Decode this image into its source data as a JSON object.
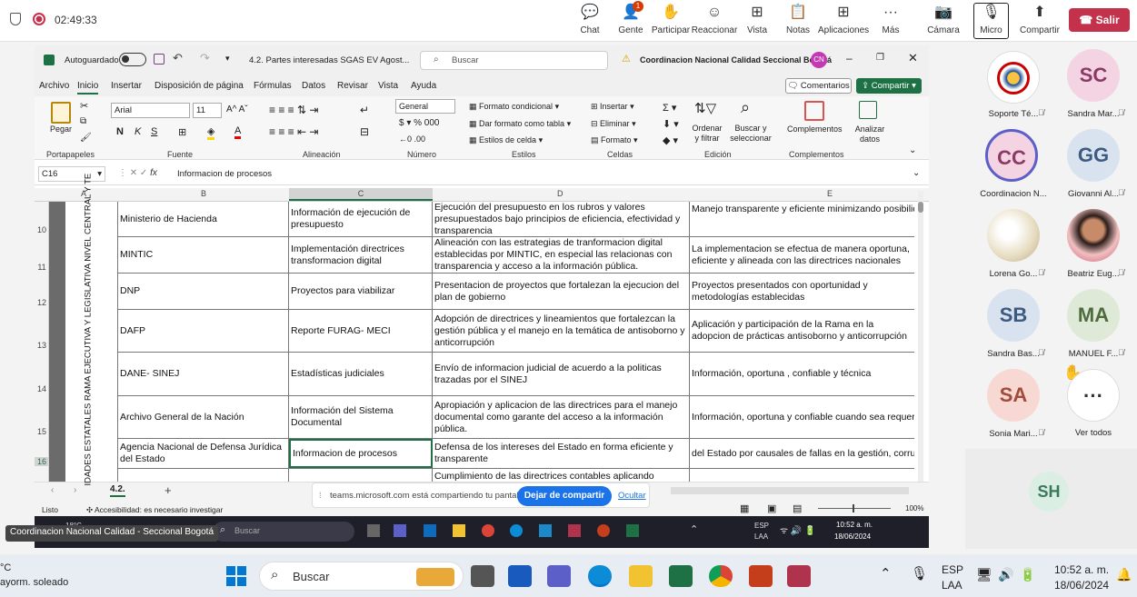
{
  "teams": {
    "timer": "02:49:33",
    "chat": "Chat",
    "people": "Gente",
    "people_badge": "1",
    "raise": "Participar",
    "react": "Reaccionar",
    "view": "Vista",
    "notes": "Notas",
    "apps": "Aplicaciones",
    "more": "Más",
    "camera": "Cámara",
    "mic": "Micro",
    "share": "Compartir",
    "leave": "Salir"
  },
  "excel": {
    "autosave": "Autoguardado",
    "filename": "4.2. Partes interesadas SGAS EV Agost...",
    "search_placeholder": "Buscar",
    "org": "Coordinacion Nacional Calidad Seccional Bogotá",
    "user_initials": "CN",
    "menus": [
      "Archivo",
      "Inicio",
      "Insertar",
      "Disposición de página",
      "Fórmulas",
      "Datos",
      "Revisar",
      "Vista",
      "Ayuda"
    ],
    "comments": "Comentarios",
    "share": "Compartir",
    "ribbon": {
      "paste": "Pegar",
      "clipboard": "Portapapeles",
      "font_name": "Arial",
      "font_size": "11",
      "font_group": "Fuente",
      "align_group": "Alineación",
      "number_format": "General",
      "number_group": "Número",
      "cond_format": "Formato condicional",
      "table_format": "Dar formato como tabla",
      "cell_styles": "Estilos de celda",
      "styles_group": "Estilos",
      "insert": "Insertar",
      "delete": "Eliminar",
      "format": "Formato",
      "cells_group": "Celdas",
      "sort_filter": "Ordenar y filtrar",
      "find_select": "Buscar y seleccionar",
      "edit_group": "Edición",
      "complements": "Complementos",
      "complements_group": "Complementos",
      "analyze": "Analizar datos"
    },
    "name_box": "C16",
    "formula": "Informacion de procesos",
    "columns": [
      "A",
      "B",
      "C",
      "D",
      "E"
    ],
    "merged_a": "IDADES ESTATALES RAMA EJECUTIVA Y LEGISLATIVA NIVEL CENTRAL Y TE",
    "rows": [
      {
        "num": "10",
        "b": "Ministerio de Hacienda",
        "c": "Información de ejecución de presupuesto",
        "d": "Ejecución del presupuesto en los rubros y valores presupuestados bajo principios de eficiencia, efectividad y transparencia",
        "e": "Manejo transparente y eficiente minimizando posibilidades de soborno y corrupción."
      },
      {
        "num": "11",
        "b": "MINTIC",
        "c": "Implementación directrices transformacion digital",
        "d": "Alineación con las estrategias de tranformacion digital establecidas por MINTIC, en especial las relacionas con transparencia y acceso a la información pública.",
        "e": "La implementacion se efectua de manera oportuna, eficiente y alineada con las directrices nacionales"
      },
      {
        "num": "12",
        "b": "DNP",
        "c": "Proyectos para viabilizar",
        "d": "Presentacion de proyectos que fortalezan la ejecucion del plan de gobierno",
        "e": "Proyectos presentados con oportunidad y metodologías establecidas"
      },
      {
        "num": "13",
        "b": "DAFP",
        "c": "Reporte FURAG- MECI",
        "d": "Adopción de directrices y lineamientos que fortalezcan la gestión pública y el manejo en la temática de antisoborno y anticorrupción",
        "e": "Aplicación y participación de la Rama en la adopcion de prácticas antisoborno y anticorrupción"
      },
      {
        "num": "14",
        "b": "DANE- SINEJ",
        "c": "Estadísticas judiciales",
        "d": "Envío de informacion judicial de acuerdo a la politicas trazadas por el SINEJ",
        "e": "Información, oportuna , confiable y técnica"
      },
      {
        "num": "15",
        "b": "Archivo General de la Nación",
        "c": "Información del Sistema Documental",
        "d": "Apropiación y aplicacion de las directrices para el manejo documental como garante del acceso a la información pública.",
        "e": "Información, oportuna y confiable cuando sea requerida"
      },
      {
        "num": "16",
        "b": "Agencia Nacional de Defensa Jurídica del Estado",
        "c": "Informacion de procesos",
        "d": "Defensa de los intereses del Estado en forma eficiente y transparente",
        "e": "del Estado por causales de fallas en la gestión, corrupción o soborno"
      },
      {
        "num": "",
        "b": "",
        "c": "",
        "d": "Cumplimiento de las directrices contables aplicando",
        "e": ""
      }
    ],
    "sheet_tab": "4.2.",
    "status_ready": "Listo",
    "accessibility": "Accesibilidad: es necesario investigar",
    "zoom": "100%",
    "share_notice": "teams.microsoft.com está compartiendo tu pantalla.",
    "stop_sharing": "Dejar de compartir",
    "hide": "Ocultar",
    "inner_taskbar": {
      "owner": "Coordinacion Nacional Calidad - Seccional Bogotá",
      "temp": "18°C",
      "search": "Buscar",
      "lang": "ESP",
      "lang2": "LAA",
      "time": "10:52 a. m.",
      "date": "18/06/2024"
    }
  },
  "participants": [
    {
      "initials": "",
      "name": "Soporte Té...",
      "bg": "#ffffff",
      "fg": "#333"
    },
    {
      "initials": "SC",
      "name": "Sandra Mar...",
      "bg": "#f4d3e2",
      "fg": "#8a3a64"
    },
    {
      "initials": "CC",
      "name": "Coordinacion N...",
      "bg": "#f4d3e2",
      "fg": "#8a3a64"
    },
    {
      "initials": "GG",
      "name": "Giovanni Al...",
      "bg": "#d9e3f0",
      "fg": "#3d5a80"
    },
    {
      "initials": "",
      "name": "Lorena Go...",
      "bg": "#ece6d4",
      "fg": "#333"
    },
    {
      "initials": "",
      "name": "Beatriz Eug...",
      "bg": "#c97a70",
      "fg": "#333"
    },
    {
      "initials": "SB",
      "name": "Sandra Bas...",
      "bg": "#d9e3f0",
      "fg": "#3d5a80"
    },
    {
      "initials": "MA",
      "name": "MANUEL F...",
      "bg": "#dfe9d8",
      "fg": "#4d6b3c"
    },
    {
      "initials": "SA",
      "name": "Sonia Mari...",
      "bg": "#f8d8d2",
      "fg": "#a04b3c"
    },
    {
      "initials": "···",
      "name": "Ver todos",
      "bg": "#ffffff",
      "fg": "#333"
    }
  ],
  "self_initials": "SH",
  "taskbar": {
    "weather_temp": "°C",
    "weather_desc": "ayorm. soleado",
    "search": "Buscar",
    "lang": "ESP",
    "lang2": "LAA",
    "time": "10:52 a. m.",
    "date": "18/06/2024"
  }
}
